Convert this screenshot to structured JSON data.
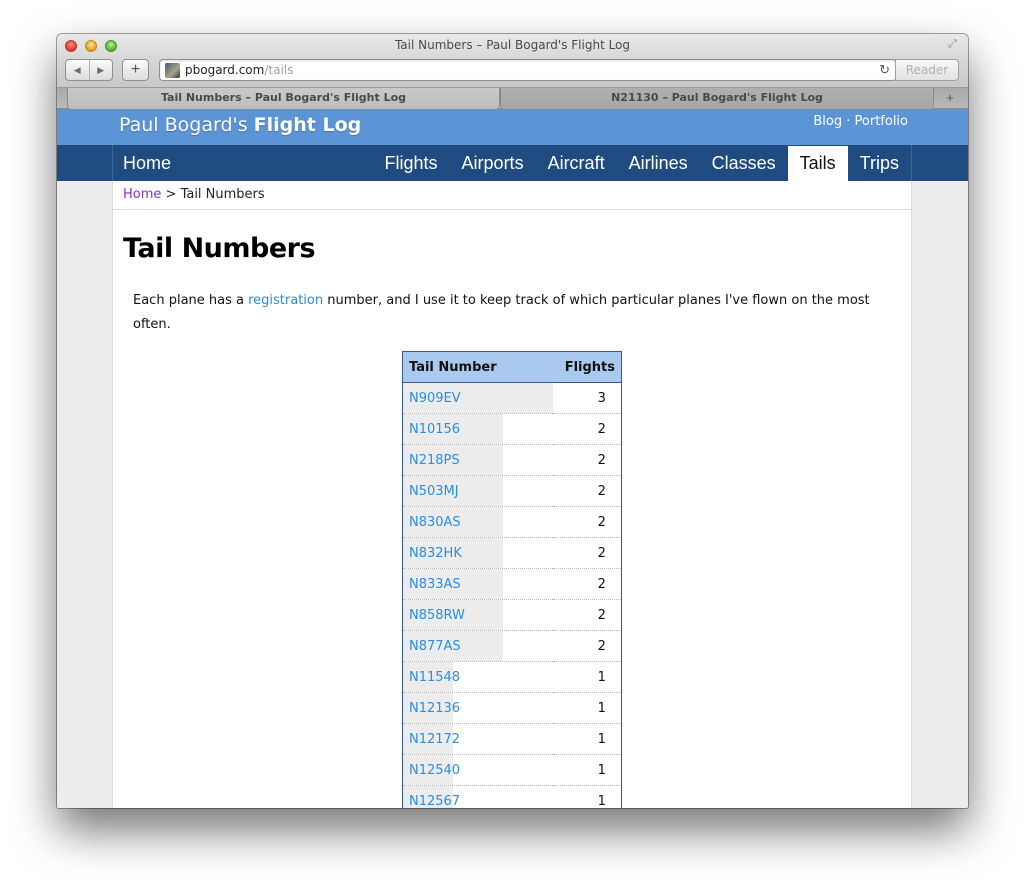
{
  "browser": {
    "window_title": "Tail Numbers – Paul Bogard's Flight Log",
    "url_domain": "pbogard.com",
    "url_path": "/tails",
    "reader_label": "Reader",
    "tabs": [
      {
        "label": "Tail Numbers – Paul Bogard's Flight Log",
        "active": true
      },
      {
        "label": "N21130 – Paul Bogard's Flight Log",
        "active": false
      }
    ],
    "icons": {
      "back": "◀",
      "forward": "▶",
      "add": "+",
      "reload": "↻",
      "fullscreen": "⤢",
      "new_tab": "+"
    }
  },
  "site": {
    "title_prefix": "Paul Bogard's ",
    "title_bold": "Flight Log",
    "header_links": [
      {
        "label": "Blog"
      },
      {
        "label": "Portfolio"
      }
    ],
    "header_separator": " · ",
    "nav_home": "Home",
    "nav_items": [
      {
        "label": "Flights",
        "active": false
      },
      {
        "label": "Airports",
        "active": false
      },
      {
        "label": "Aircraft",
        "active": false
      },
      {
        "label": "Airlines",
        "active": false
      },
      {
        "label": "Classes",
        "active": false
      },
      {
        "label": "Tails",
        "active": true
      },
      {
        "label": "Trips",
        "active": false
      }
    ]
  },
  "breadcrumb": {
    "home": "Home",
    "separator": " > ",
    "current": "Tail Numbers"
  },
  "page": {
    "heading": "Tail Numbers",
    "intro_before": "Each plane has a ",
    "intro_link": "registration",
    "intro_after": " number, and I use it to keep track of which particular planes I've flown on the most often."
  },
  "table": {
    "headers": {
      "tail": "Tail Number",
      "flights": "Flights"
    },
    "max_flights": 3,
    "rows": [
      {
        "tail": "N909EV",
        "flights": 3
      },
      {
        "tail": "N10156",
        "flights": 2
      },
      {
        "tail": "N218PS",
        "flights": 2
      },
      {
        "tail": "N503MJ",
        "flights": 2
      },
      {
        "tail": "N830AS",
        "flights": 2
      },
      {
        "tail": "N832HK",
        "flights": 2
      },
      {
        "tail": "N833AS",
        "flights": 2
      },
      {
        "tail": "N858RW",
        "flights": 2
      },
      {
        "tail": "N877AS",
        "flights": 2
      },
      {
        "tail": "N11548",
        "flights": 1
      },
      {
        "tail": "N12136",
        "flights": 1
      },
      {
        "tail": "N12172",
        "flights": 1
      },
      {
        "tail": "N12540",
        "flights": 1
      },
      {
        "tail": "N12567",
        "flights": 1
      }
    ]
  },
  "colors": {
    "header_bg": "#5b95d6",
    "nav_bg": "#1f4b80",
    "link": "#2a8ee0",
    "visited_link": "#8a2fc4",
    "table_header_bg": "#a9c9ef",
    "bar_fill": "#ececec"
  }
}
